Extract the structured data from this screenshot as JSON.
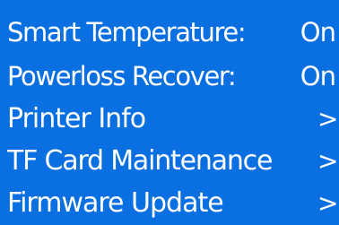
{
  "menu": {
    "items": [
      {
        "label": "Smart Temperature:",
        "value": "On"
      },
      {
        "label": "Powerloss Recover:",
        "value": "On"
      },
      {
        "label": "Printer Info",
        "chevron": ">"
      },
      {
        "label": "TF Card Maintenance",
        "chevron": ">"
      },
      {
        "label": "Firmware Update",
        "chevron": ">"
      }
    ]
  },
  "colors": {
    "background": "#0a6fe0",
    "text": "#ffffff"
  },
  "icons": {
    "chevron": "chevron-right-icon"
  }
}
